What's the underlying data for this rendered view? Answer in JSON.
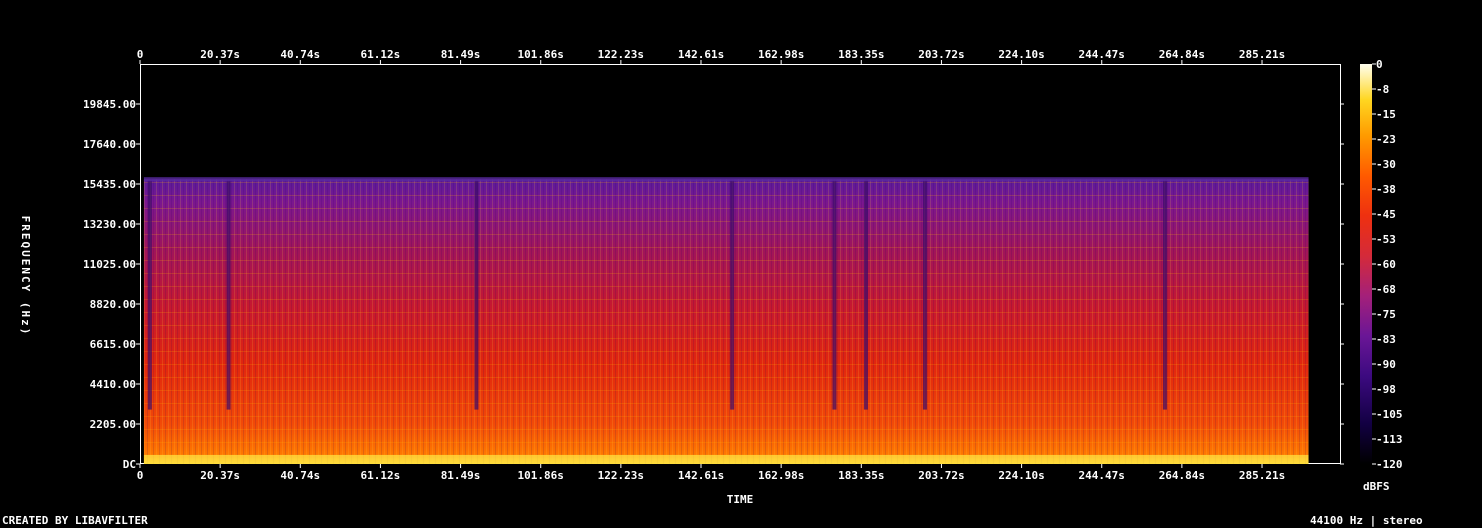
{
  "chart_data": {
    "type": "heatmap",
    "title": "",
    "xlabel": "TIME",
    "ylabel": "FREQUENCY (Hz)",
    "x_ticks": [
      "0",
      "20.37s",
      "40.74s",
      "61.12s",
      "81.49s",
      "101.86s",
      "122.23s",
      "142.61s",
      "162.98s",
      "183.35s",
      "203.72s",
      "224.10s",
      "244.47s",
      "264.84s",
      "285.21s"
    ],
    "x_range_seconds": [
      0,
      305
    ],
    "y_ticks": [
      "DC",
      "2205.00",
      "4410.00",
      "6615.00",
      "8820.00",
      "11025.00",
      "13230.00",
      "15435.00",
      "17640.00",
      "19845.00"
    ],
    "y_range_hz": [
      0,
      22050
    ],
    "content_cutoff_hz": 15700,
    "colorbar": {
      "label": "dBFS",
      "ticks": [
        "0",
        "-8",
        "-15",
        "-23",
        "-30",
        "-38",
        "-45",
        "-53",
        "-60",
        "-68",
        "-75",
        "-83",
        "-90",
        "-98",
        "-105",
        "-113",
        "-120"
      ],
      "range_db": [
        -120,
        0
      ],
      "colors": [
        "#000000",
        "#12004a",
        "#4b0c8a",
        "#8e1ca0",
        "#cc2a4a",
        "#e82a10",
        "#ff6a00",
        "#ffb000",
        "#ffee40",
        "#ffffd0"
      ]
    },
    "dark_time_bands_seconds": [
      2,
      22,
      85,
      150,
      176,
      184,
      199,
      260
    ]
  },
  "footer": {
    "left_text": "CREATED BY LIBAVFILTER",
    "right_text": "44100 Hz | stereo"
  }
}
